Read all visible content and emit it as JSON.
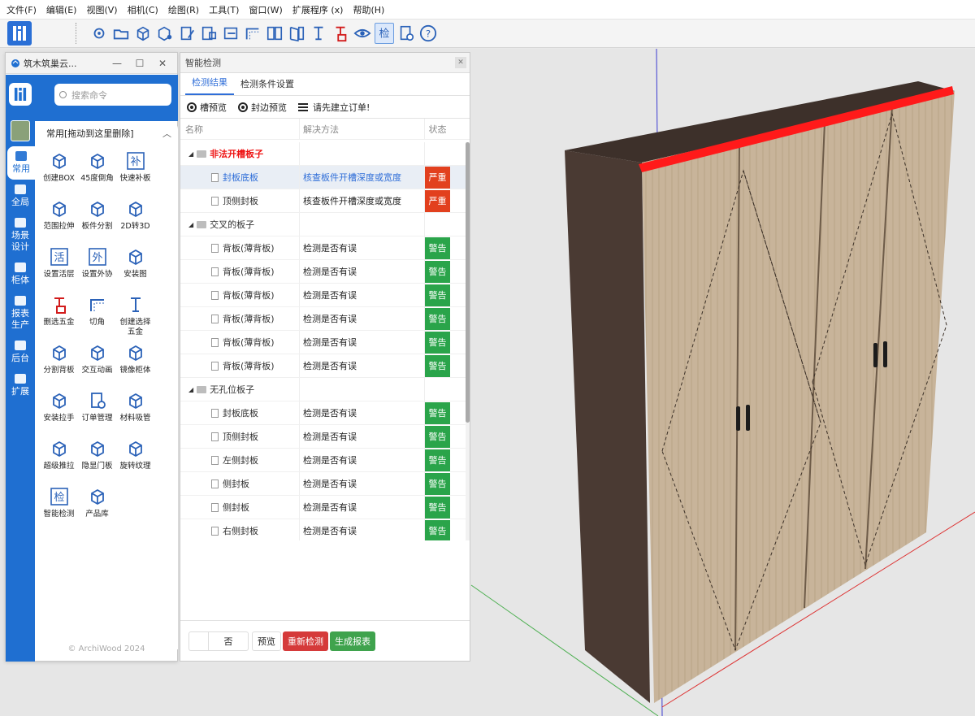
{
  "menu": [
    "文件(F)",
    "编辑(E)",
    "视图(V)",
    "相机(C)",
    "绘图(R)",
    "工具(T)",
    "窗口(W)",
    "扩展程序 (x)",
    "帮助(H)"
  ],
  "toolbar": {
    "active_label": "检",
    "icons": [
      "gear-icon",
      "folder-icon",
      "box-icon",
      "box-settings-icon",
      "panel-edit-icon",
      "panel-copy-icon",
      "panel-insert-icon",
      "corner-cut-icon",
      "door-mirror-icon",
      "door-open-icon",
      "hardware-select-icon",
      "hardware-delete-icon",
      "eye-icon",
      "smart-check-icon",
      "order-icon",
      "help-icon"
    ]
  },
  "plugin": {
    "title": "筑木筑巢云...",
    "search_placeholder": "搜索命令",
    "nav": [
      {
        "label": "常用",
        "active": true
      },
      {
        "label": "全局",
        "active": false
      },
      {
        "label": "场景\n设计",
        "active": false
      },
      {
        "label": "柜体",
        "active": false
      },
      {
        "label": "报表\n生产",
        "active": false
      },
      {
        "label": "后台",
        "active": false
      },
      {
        "label": "扩展",
        "active": false
      }
    ],
    "panel_header": "常用[拖动到这里删除]",
    "commands": [
      {
        "label": "创建BOX",
        "icon": "cube-icon",
        "glyph": "",
        "red": false
      },
      {
        "label": "45度倒角",
        "icon": "chamfer-icon",
        "glyph": "",
        "red": false
      },
      {
        "label": "快速补板",
        "icon": "fill-board-icon",
        "glyph": "补",
        "red": false
      },
      {
        "label": "范围拉伸",
        "icon": "stretch-icon",
        "glyph": "",
        "red": false
      },
      {
        "label": "板件分割",
        "icon": "split-board-icon",
        "glyph": "",
        "red": false
      },
      {
        "label": "2D转3D",
        "icon": "convert-3d-icon",
        "glyph": "",
        "red": false
      },
      {
        "label": "设置活层",
        "icon": "active-layer-icon",
        "glyph": "活",
        "red": false
      },
      {
        "label": "设置外协",
        "icon": "outsource-icon",
        "glyph": "外",
        "red": false
      },
      {
        "label": "安装图",
        "icon": "cloud-upload-icon",
        "glyph": "",
        "red": false
      },
      {
        "label": "删选五金",
        "icon": "hardware-delete-icon",
        "glyph": "",
        "red": true
      },
      {
        "label": "切角",
        "icon": "corner-cut-icon",
        "glyph": "",
        "red": false
      },
      {
        "label": "创建选择\n五金",
        "icon": "hardware-select-icon",
        "glyph": "",
        "red": false
      },
      {
        "label": "分割背板",
        "icon": "split-back-icon",
        "glyph": "",
        "red": false
      },
      {
        "label": "交互动画",
        "icon": "animation-icon",
        "glyph": "",
        "red": false
      },
      {
        "label": "镜像柜体",
        "icon": "mirror-cabinet-icon",
        "glyph": "",
        "red": false
      },
      {
        "label": "安装拉手",
        "icon": "handle-icon",
        "glyph": "",
        "red": false
      },
      {
        "label": "订单管理",
        "icon": "order-icon",
        "glyph": "",
        "red": false
      },
      {
        "label": "材料吸管",
        "icon": "eyedropper-icon",
        "glyph": "",
        "red": false
      },
      {
        "label": "超级推拉",
        "icon": "push-pull-icon",
        "glyph": "",
        "red": false
      },
      {
        "label": "隐显门板",
        "icon": "door-visibility-icon",
        "glyph": "",
        "red": false
      },
      {
        "label": "旋转纹理",
        "icon": "rotate-texture-icon",
        "glyph": "",
        "red": false
      },
      {
        "label": "智能检测",
        "icon": "smart-check-icon",
        "glyph": "检",
        "red": false
      },
      {
        "label": "产品库",
        "icon": "product-library-icon",
        "glyph": "",
        "red": false
      }
    ],
    "copyright": "© ArchiWood 2024"
  },
  "detect": {
    "title": "智能检测",
    "tabs": [
      {
        "label": "检测结果",
        "active": true
      },
      {
        "label": "检测条件设置",
        "active": false
      }
    ],
    "actions": {
      "groove_preview": "槽预览",
      "edge_preview": "封边预览",
      "order_notice": "请先建立订单!"
    },
    "columns": {
      "name": "名称",
      "solution": "解决方法",
      "status": "状态"
    },
    "rows": [
      {
        "type": "group",
        "name": "非法开槽板子",
        "red": true
      },
      {
        "type": "item",
        "name": "封板底板",
        "solution": "核查板件开槽深度或宽度",
        "status": "严重",
        "level": "red",
        "selected": true
      },
      {
        "type": "item",
        "name": "顶侧封板",
        "solution": "核查板件开槽深度或宽度",
        "status": "严重",
        "level": "red",
        "selected": false
      },
      {
        "type": "group",
        "name": "交叉的板子",
        "red": false
      },
      {
        "type": "item",
        "name": "背板(薄背板)",
        "solution": "检测是否有误",
        "status": "警告",
        "level": "green",
        "selected": false
      },
      {
        "type": "item",
        "name": "背板(薄背板)",
        "solution": "检测是否有误",
        "status": "警告",
        "level": "green",
        "selected": false
      },
      {
        "type": "item",
        "name": "背板(薄背板)",
        "solution": "检测是否有误",
        "status": "警告",
        "level": "green",
        "selected": false
      },
      {
        "type": "item",
        "name": "背板(薄背板)",
        "solution": "检测是否有误",
        "status": "警告",
        "level": "green",
        "selected": false
      },
      {
        "type": "item",
        "name": "背板(薄背板)",
        "solution": "检测是否有误",
        "status": "警告",
        "level": "green",
        "selected": false
      },
      {
        "type": "item",
        "name": "背板(薄背板)",
        "solution": "检测是否有误",
        "status": "警告",
        "level": "green",
        "selected": false
      },
      {
        "type": "group",
        "name": "无孔位板子",
        "red": false
      },
      {
        "type": "item",
        "name": "封板底板",
        "solution": "检测是否有误",
        "status": "警告",
        "level": "green",
        "selected": false
      },
      {
        "type": "item",
        "name": "顶侧封板",
        "solution": "检测是否有误",
        "status": "警告",
        "level": "green",
        "selected": false
      },
      {
        "type": "item",
        "name": "左侧封板",
        "solution": "检测是否有误",
        "status": "警告",
        "level": "green",
        "selected": false
      },
      {
        "type": "item",
        "name": "侧封板",
        "solution": "检测是否有误",
        "status": "警告",
        "level": "green",
        "selected": false
      },
      {
        "type": "item",
        "name": "侧封板",
        "solution": "检测是否有误",
        "status": "警告",
        "level": "green",
        "selected": false
      },
      {
        "type": "item",
        "name": "右侧封板",
        "solution": "检测是否有误",
        "status": "警告",
        "level": "green",
        "selected": false
      }
    ],
    "footer": {
      "toggle_value": "否",
      "preview": "预览",
      "recheck": "重新检测",
      "report": "生成报表"
    }
  },
  "colors": {
    "primary": "#1f6fd1",
    "danger": "#e2401e",
    "warning_ok": "#2aa44a",
    "highlight": "#ff1a1a"
  }
}
